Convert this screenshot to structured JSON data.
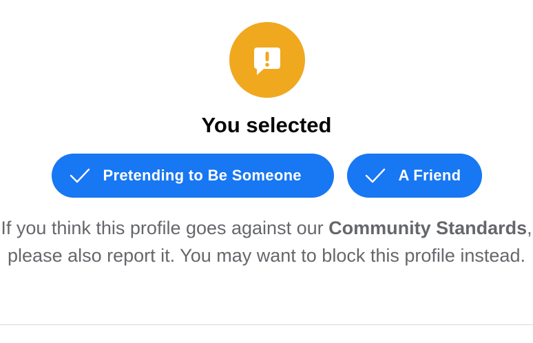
{
  "header": {
    "icon": "speech-bubble-exclamation-icon",
    "icon_color": "#f0a81f",
    "title": "You selected"
  },
  "selected_chips": [
    {
      "label": "Pretending to Be Someone",
      "icon": "checkmark-icon"
    },
    {
      "label": "A Friend",
      "icon": "checkmark-icon"
    }
  ],
  "description": {
    "part1": "If you think this profile goes against our ",
    "bold": "Community Standards",
    "part2": ", please also report it. You may want to block this profile instead."
  },
  "colors": {
    "accent": "#1877f2",
    "warning": "#f0a81f",
    "text_primary": "#050505",
    "text_secondary": "#65676b"
  }
}
